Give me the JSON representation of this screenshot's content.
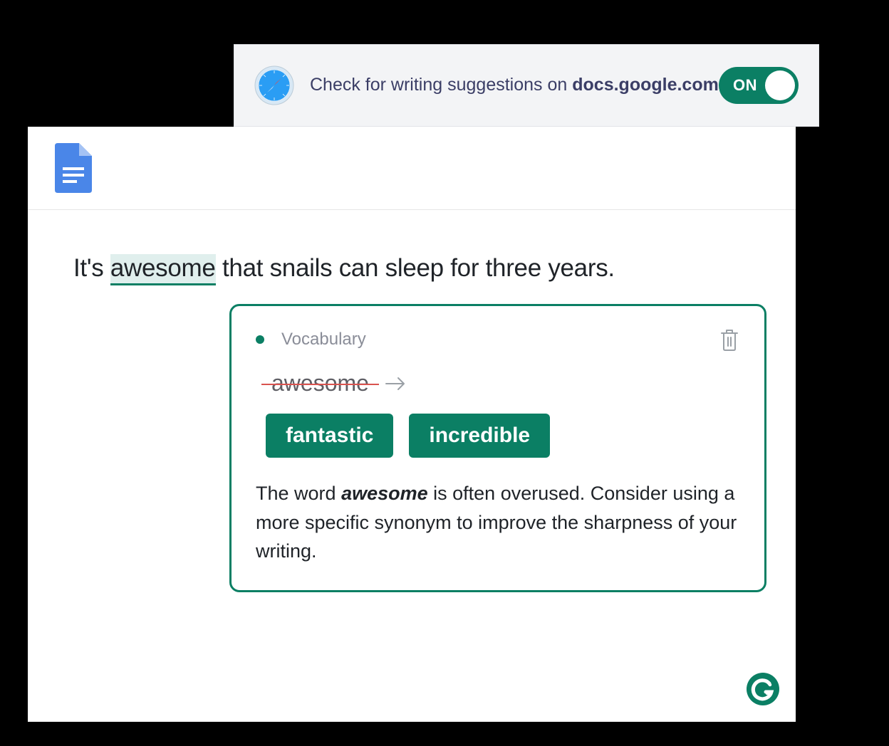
{
  "banner": {
    "text_prefix": "Check for writing suggestions on ",
    "domain": "docs.google.com",
    "toggle_label": "ON",
    "toggle_state": true
  },
  "document": {
    "sentence_before": "It's ",
    "sentence_highlight": "awesome",
    "sentence_after": " that snails can sleep for three years."
  },
  "card": {
    "category": "Vocabulary",
    "strike_word": "awesome",
    "suggestions": [
      "fantastic",
      "incredible"
    ],
    "explanation_before": "The word ",
    "explanation_bold": "awesome",
    "explanation_after": " is often overused. Consider using a more specific synonym to improve the sharpness of your writing."
  }
}
